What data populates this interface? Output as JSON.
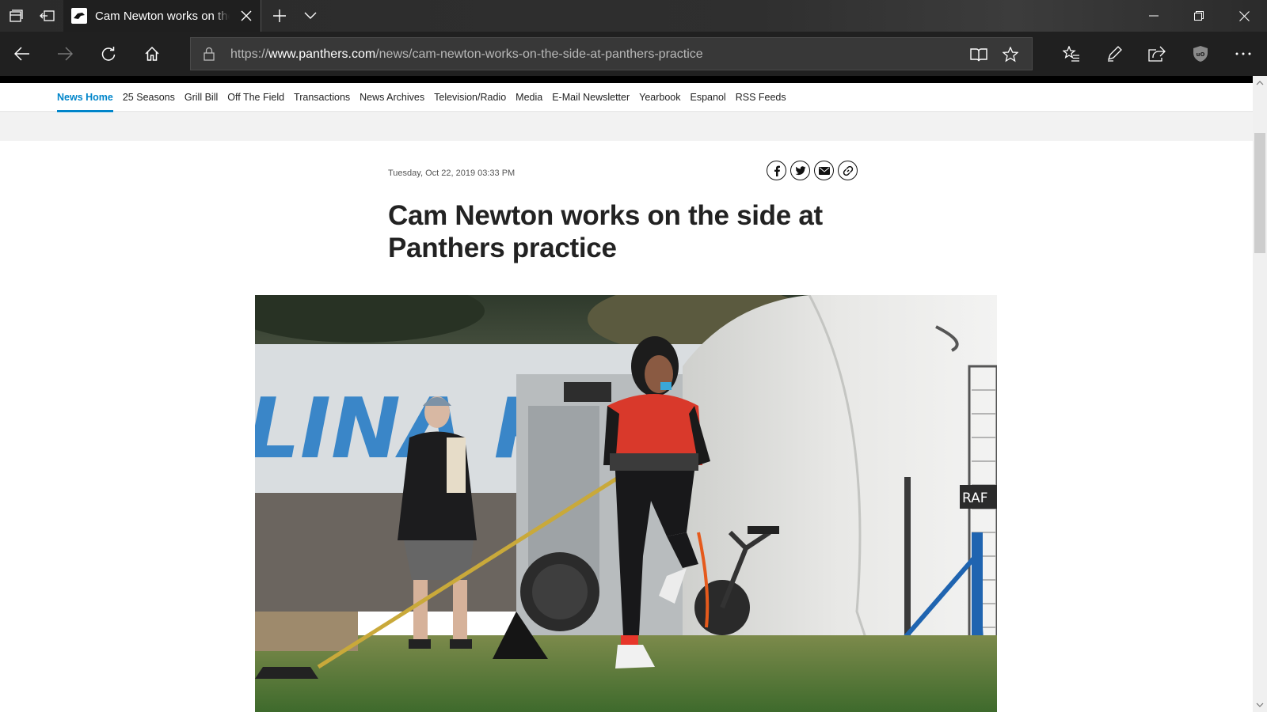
{
  "browser": {
    "tab_title": "Cam Newton works on the side at Panthers practice",
    "url_prefix": "https://",
    "url_host": "www.panthers.com",
    "url_path": "/news/cam-newton-works-on-the-side-at-panthers-practice"
  },
  "subnav": {
    "items": [
      "News Home",
      "25 Seasons",
      "Grill Bill",
      "Off The Field",
      "Transactions",
      "News Archives",
      "Television/Radio",
      "Media",
      "E-Mail Newsletter",
      "Yearbook",
      "Espanol",
      "RSS Feeds"
    ],
    "active_index": 0
  },
  "article": {
    "date": "Tuesday, Oct 22, 2019 03:33 PM",
    "headline": "Cam Newton works on the side at Panthers practice",
    "banner_text": "LINA PA",
    "sign_text": "RAF"
  },
  "colors": {
    "accent": "#0085ca",
    "chrome_dark": "#202020"
  }
}
